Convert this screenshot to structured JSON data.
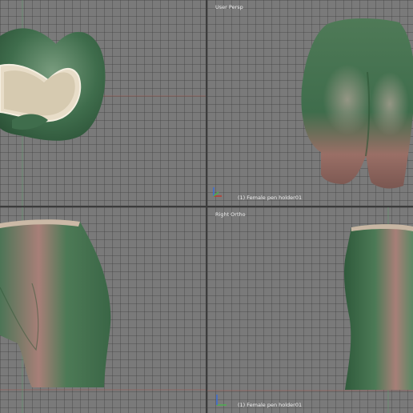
{
  "viewports": {
    "top_left": {
      "label": ""
    },
    "top_right": {
      "label": "User Persp",
      "object_label": "(1) Female pen holder01"
    },
    "bottom_left": {
      "label": ""
    },
    "bottom_right": {
      "label": "Right Ortho",
      "object_label": "(1) Female pen holder01"
    }
  },
  "colors": {
    "viewport_bg": "#7a7a7a",
    "grid_line": "#6b6b6b",
    "divider": "#3c3c3c",
    "mesh_green": "#3f6d4c",
    "mesh_pink": "#a87f78",
    "mesh_inner": "#d8cdb6",
    "axis_x": "#c0392b",
    "axis_y": "#4caf50",
    "axis_z": "#3a6dd8"
  }
}
